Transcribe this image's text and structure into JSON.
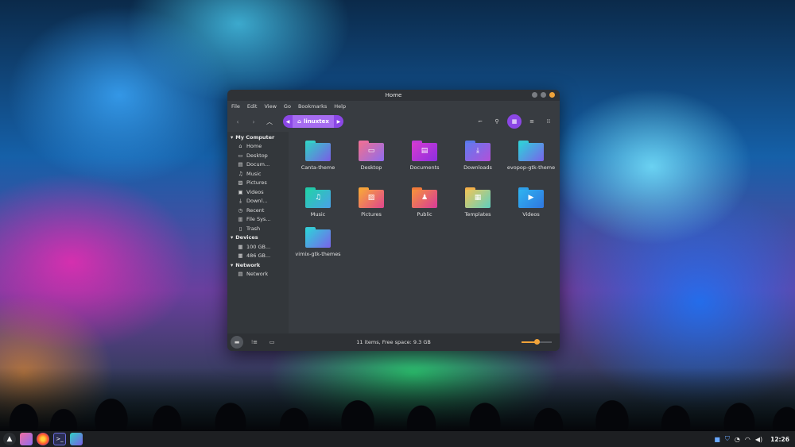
{
  "window": {
    "title": "Home",
    "menu": [
      "File",
      "Edit",
      "View",
      "Go",
      "Bookmarks",
      "Help"
    ],
    "path": "linuxtex"
  },
  "sidebar": {
    "sections": [
      {
        "title": "My Computer",
        "items": [
          {
            "label": "Home",
            "icon": "home-icon",
            "glyph": "⌂"
          },
          {
            "label": "Desktop",
            "icon": "desktop-icon",
            "glyph": "▭"
          },
          {
            "label": "Docum...",
            "icon": "document-icon",
            "glyph": "▤"
          },
          {
            "label": "Music",
            "icon": "music-icon",
            "glyph": "♫"
          },
          {
            "label": "Pictures",
            "icon": "picture-icon",
            "glyph": "▨"
          },
          {
            "label": "Videos",
            "icon": "video-icon",
            "glyph": "▣"
          },
          {
            "label": "Downl...",
            "icon": "download-icon",
            "glyph": "⤓"
          },
          {
            "label": "Recent",
            "icon": "recent-icon",
            "glyph": "◷"
          },
          {
            "label": "File Sys...",
            "icon": "filesystem-icon",
            "glyph": "▥"
          },
          {
            "label": "Trash",
            "icon": "trash-icon",
            "glyph": "▯"
          }
        ]
      },
      {
        "title": "Devices",
        "items": [
          {
            "label": "100 GB...",
            "icon": "drive-icon",
            "glyph": "▦"
          },
          {
            "label": "486 GB...",
            "icon": "drive-icon",
            "glyph": "▦"
          }
        ]
      },
      {
        "title": "Network",
        "items": [
          {
            "label": "Network",
            "icon": "network-icon",
            "glyph": "▤"
          }
        ]
      }
    ]
  },
  "folders": [
    {
      "label": "Canta-theme",
      "icon": "folder-icon",
      "glyph": "",
      "tab": "#36cfc9",
      "grad": [
        "#2fd1c4",
        "#7b5ce6"
      ]
    },
    {
      "label": "Desktop",
      "icon": "folder-desktop-icon",
      "glyph": "▭",
      "tab": "#e96fa0",
      "grad": [
        "#f0708f",
        "#8e6cf0"
      ]
    },
    {
      "label": "Documents",
      "icon": "folder-documents-icon",
      "glyph": "▤",
      "tab": "#c23bd6",
      "grad": [
        "#d63bd0",
        "#8c2fe0"
      ]
    },
    {
      "label": "Downloads",
      "icon": "folder-downloads-icon",
      "glyph": "⤓",
      "tab": "#5a76e8",
      "grad": [
        "#5f7bf0",
        "#b350d8"
      ]
    },
    {
      "label": "evopop-gtk-theme",
      "icon": "folder-icon",
      "glyph": "",
      "tab": "#38c9d6",
      "grad": [
        "#2cd4d9",
        "#7a62ea"
      ]
    },
    {
      "label": "Music",
      "icon": "folder-music-icon",
      "glyph": "♫",
      "tab": "#22c7a8",
      "grad": [
        "#21d3a7",
        "#4aa0e8"
      ]
    },
    {
      "label": "Pictures",
      "icon": "folder-pictures-icon",
      "glyph": "▨",
      "tab": "#f5a23b",
      "grad": [
        "#f8a838",
        "#e0458e"
      ]
    },
    {
      "label": "Public",
      "icon": "folder-public-icon",
      "glyph": "♟",
      "tab": "#f07a3a",
      "grad": [
        "#f6933a",
        "#d83a9a"
      ]
    },
    {
      "label": "Templates",
      "icon": "folder-templates-icon",
      "glyph": "▦",
      "tab": "#f2b04a",
      "grad": [
        "#f0c658",
        "#5fd0c0"
      ]
    },
    {
      "label": "Videos",
      "icon": "folder-videos-icon",
      "glyph": "▶",
      "tab": "#2f9fe8",
      "grad": [
        "#2fb4f0",
        "#2f76e0"
      ]
    },
    {
      "label": "vimix-gtk-themes",
      "icon": "folder-icon",
      "glyph": "",
      "tab": "#38c9d6",
      "grad": [
        "#2cd4d9",
        "#7a62ea"
      ]
    }
  ],
  "status": {
    "text": "11 items, Free space: 9.3 GB",
    "zoom_fraction": 0.5
  },
  "taskbar": {
    "clock": "12:26",
    "accent": "#8b47e5",
    "highlight": "#f1a33a"
  }
}
